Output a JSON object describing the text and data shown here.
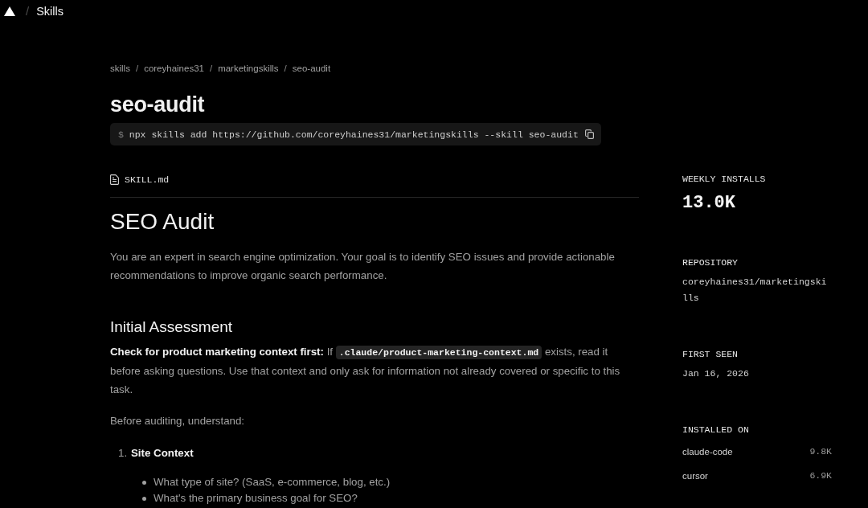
{
  "top_bar": {
    "separator": "/",
    "section": "Skills"
  },
  "breadcrumb": {
    "separator": "/",
    "items": [
      "skills",
      "coreyhaines31",
      "marketingskills",
      "seo-audit"
    ]
  },
  "title": "seo-audit",
  "install_command": {
    "prompt": "$",
    "command": "npx skills add https://github.com/coreyhaines31/marketingskills --skill seo-audit"
  },
  "file": {
    "name": "SKILL.md"
  },
  "document": {
    "heading": "SEO Audit",
    "intro": "You are an expert in search engine optimization. Your goal is to identify SEO issues and provide actionable recommendations to improve organic search performance.",
    "sections": [
      {
        "heading": "Initial Assessment",
        "blocks": [
          {
            "kind": "segments",
            "segments": [
              {
                "kind": "bold",
                "text": "Check for product marketing context first:"
              },
              {
                "kind": "text",
                "text": " If "
              },
              {
                "kind": "code",
                "text": ".claude/product-marketing-context.md"
              },
              {
                "kind": "text",
                "text": " exists, read it before asking questions. Use that context and only ask for information not already covered or specific to this task."
              }
            ]
          },
          {
            "kind": "paragraph",
            "text": "Before auditing, understand:"
          },
          {
            "kind": "ordered_list",
            "items": [
              {
                "number": "1.",
                "title": "Site Context",
                "children": [
                  {
                    "text": "What type of site? (SaaS, e-commerce, blog, etc.)"
                  },
                  {
                    "text": "What's the primary business goal for SEO?"
                  }
                ]
              }
            ]
          }
        ]
      }
    ]
  },
  "sidebar": [
    {
      "kind": "big",
      "label": "WEEKLY INSTALLS",
      "value": "13.0K"
    },
    {
      "kind": "link",
      "label": "REPOSITORY",
      "value": "coreyhaines31/marketingskills"
    },
    {
      "kind": "text",
      "label": "FIRST SEEN",
      "value": "Jan 16, 2026"
    },
    {
      "kind": "list",
      "label": "INSTALLED ON",
      "rows": [
        {
          "name": "claude-code",
          "count": "9.8K"
        },
        {
          "name": "cursor",
          "count": "6.9K"
        }
      ]
    }
  ]
}
